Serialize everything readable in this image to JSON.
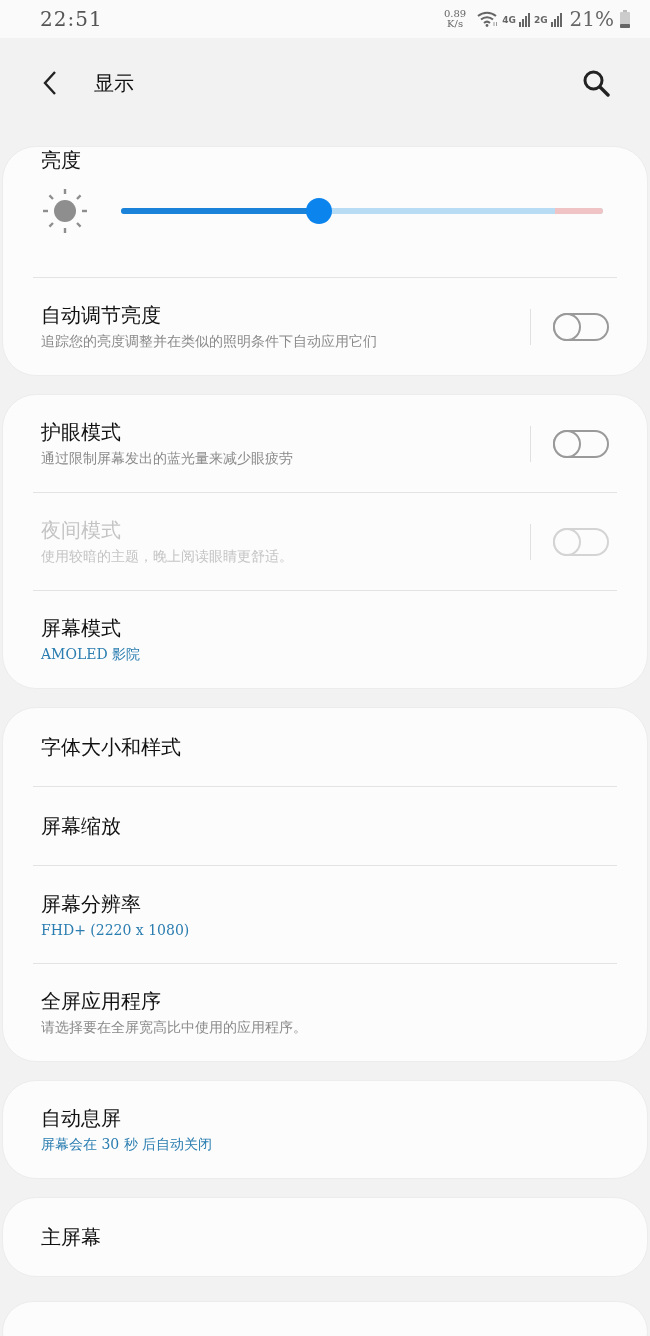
{
  "status_bar": {
    "time": "22:51",
    "net_speed_value": "0.89",
    "net_speed_unit": "K/s",
    "network_1": "4G",
    "network_2": "2G",
    "battery": "21%"
  },
  "header": {
    "title": "显示"
  },
  "brightness": {
    "title": "亮度",
    "level": 0.41
  },
  "sections": [
    {
      "items": [
        {
          "kind": "toggle",
          "title": "自动调节亮度",
          "description": "追踪您的亮度调整并在类似的照明条件下自动应用它们",
          "on": false,
          "disabled": false
        }
      ]
    },
    {
      "items": [
        {
          "kind": "toggle",
          "title": "护眼模式",
          "description": "通过限制屏幕发出的蓝光量来减少眼疲劳",
          "on": false,
          "disabled": false
        },
        {
          "kind": "toggle",
          "title": "夜间模式",
          "description": "使用较暗的主题，晚上阅读眼睛更舒适。",
          "on": false,
          "disabled": true
        },
        {
          "kind": "link",
          "title": "屏幕模式",
          "value": "AMOLED 影院"
        }
      ]
    },
    {
      "items": [
        {
          "kind": "link",
          "title": "字体大小和样式"
        },
        {
          "kind": "link",
          "title": "屏幕缩放"
        },
        {
          "kind": "link",
          "title": "屏幕分辨率",
          "value": "FHD+ (2220 x 1080)"
        },
        {
          "kind": "link",
          "title": "全屏应用程序",
          "description": "请选择要在全屏宽高比中使用的应用程序。"
        }
      ]
    },
    {
      "items": [
        {
          "kind": "link",
          "title": "自动息屏",
          "value": "屏幕会在 30 秒 后自动关闭"
        }
      ]
    },
    {
      "items": [
        {
          "kind": "link",
          "title": "主屏幕"
        }
      ]
    }
  ]
}
